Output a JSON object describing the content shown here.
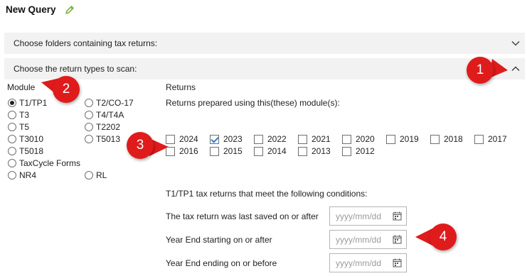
{
  "header": {
    "title": "New Query",
    "edit_icon": "pencil-icon"
  },
  "sections": {
    "folders": {
      "label": "Choose folders containing tax returns:",
      "state": "collapsed"
    },
    "return_types": {
      "label": "Choose the return types to scan:",
      "state": "expanded"
    }
  },
  "module": {
    "heading": "Module",
    "selected": "T1/TP1",
    "options": [
      "T1/TP1",
      "T2/CO-17",
      "T3",
      "T4/T4A",
      "T5",
      "T2202",
      "T3010",
      "T5013",
      "T5018",
      "TaxCycle Forms",
      "NR4",
      "RL"
    ]
  },
  "returns": {
    "heading": "Returns",
    "subheading": "Returns prepared using this(these) module(s):",
    "years": [
      {
        "label": "2024",
        "checked": false
      },
      {
        "label": "2023",
        "checked": true
      },
      {
        "label": "2022",
        "checked": false
      },
      {
        "label": "2021",
        "checked": false
      },
      {
        "label": "2020",
        "checked": false
      },
      {
        "label": "2019",
        "checked": false
      },
      {
        "label": "2018",
        "checked": false
      },
      {
        "label": "2017",
        "checked": false
      },
      {
        "label": "2016",
        "checked": false
      },
      {
        "label": "2015",
        "checked": false
      },
      {
        "label": "2014",
        "checked": false
      },
      {
        "label": "2013",
        "checked": false
      },
      {
        "label": "2012",
        "checked": false
      }
    ]
  },
  "conditions": {
    "heading": "T1/TP1 tax returns that meet the following conditions:",
    "rows": [
      {
        "label": "The tax return was last saved on or after",
        "placeholder": "yyyy/mm/dd",
        "value": ""
      },
      {
        "label": "Year End starting on or after",
        "placeholder": "yyyy/mm/dd",
        "value": ""
      },
      {
        "label": "Year End ending on or before",
        "placeholder": "yyyy/mm/dd",
        "value": ""
      }
    ]
  },
  "callouts": [
    "1",
    "2",
    "3",
    "4"
  ],
  "colors": {
    "callout": "#e01b1b",
    "section_bg": "#f2f2f2",
    "check": "#2a7fd4",
    "pencil": "#7cb342"
  }
}
